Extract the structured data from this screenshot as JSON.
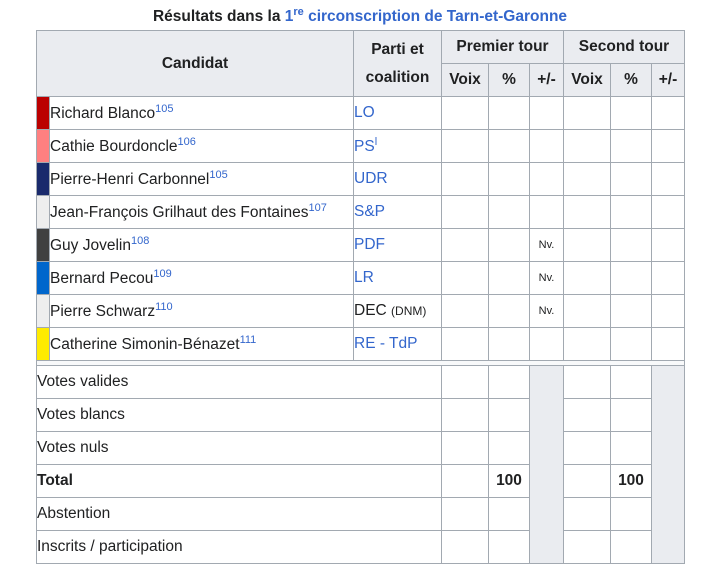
{
  "caption": {
    "prefix": "Résultats dans la ",
    "ordinal_num": "1",
    "ordinal_sup": "re",
    "link_text": " circonscription de Tarn-et-Garonne"
  },
  "headers": {
    "candidat": "Candidat",
    "parti_line1": "Parti et",
    "parti_line2": "coalition",
    "premier_tour": "Premier tour",
    "second_tour": "Second tour",
    "voix": "Voix",
    "pct": "%",
    "diff": "+/-"
  },
  "candidates": [
    {
      "name": "Richard Blanco",
      "ref": "105",
      "party": "LO",
      "party_sup": "",
      "party_extra": "",
      "party_link": true,
      "color": "#bb0000",
      "nv": ""
    },
    {
      "name": "Cathie Bourdoncle",
      "ref": "106",
      "party": "PS",
      "party_sup": "l",
      "party_extra": "",
      "party_link": true,
      "color": "#ff8080",
      "nv": ""
    },
    {
      "name": "Pierre-Henri Carbonnel",
      "ref": "105",
      "party": "UDR",
      "party_sup": "",
      "party_extra": "",
      "party_link": true,
      "color": "#1a2a6c",
      "nv": ""
    },
    {
      "name": "Jean-François Grilhaut des Fontaines",
      "ref": "107",
      "party": "S&P",
      "party_sup": "",
      "party_extra": "",
      "party_link": true,
      "color": "#eeeeee",
      "nv": ""
    },
    {
      "name": "Guy Jovelin",
      "ref": "108",
      "party": "PDF",
      "party_sup": "",
      "party_extra": "",
      "party_link": true,
      "color": "#404040",
      "nv": "Nv."
    },
    {
      "name": "Bernard Pecou",
      "ref": "109",
      "party": "LR",
      "party_sup": "",
      "party_extra": "",
      "party_link": true,
      "color": "#0066cc",
      "nv": "Nv."
    },
    {
      "name": "Pierre Schwarz",
      "ref": "110",
      "party": "DEC",
      "party_sup": "",
      "party_extra": "(DNM)",
      "party_link": false,
      "color": "#eeeeee",
      "nv": "Nv."
    },
    {
      "name": "Catherine Simonin-Bénazet",
      "ref": "111",
      "party": "RE - TdP",
      "party_sup": "",
      "party_extra": "",
      "party_link": true,
      "color": "#ffeb00",
      "nv": ""
    }
  ],
  "summary": [
    {
      "label": "Votes valides",
      "bold": false,
      "pct1": "",
      "pct2": ""
    },
    {
      "label": "Votes blancs",
      "bold": false,
      "pct1": "",
      "pct2": ""
    },
    {
      "label": "Votes nuls",
      "bold": false,
      "pct1": "",
      "pct2": ""
    },
    {
      "label": "Total",
      "bold": true,
      "pct1": "100",
      "pct2": "100"
    },
    {
      "label": "Abstention",
      "bold": false,
      "pct1": "",
      "pct2": ""
    },
    {
      "label": "Inscrits / participation",
      "bold": false,
      "pct1": "",
      "pct2": ""
    }
  ]
}
